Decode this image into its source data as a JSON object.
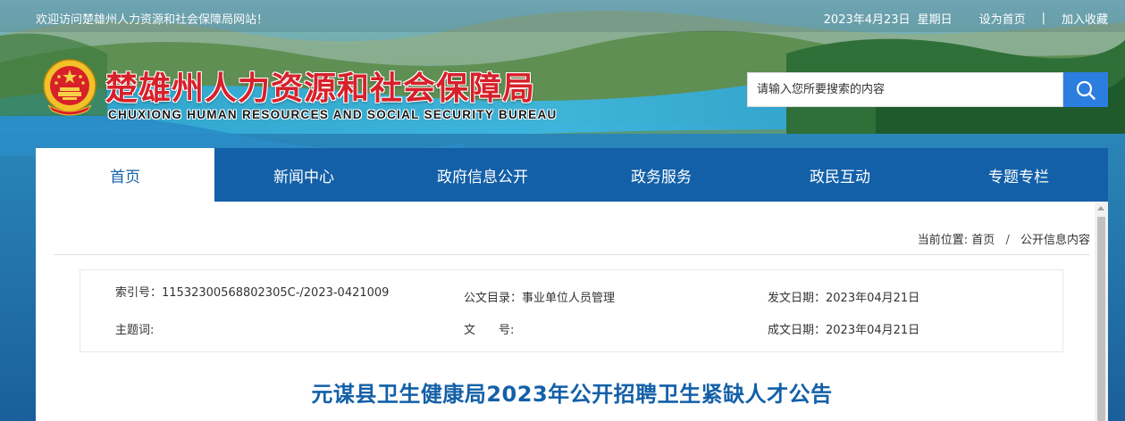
{
  "topbar": {
    "welcome": "欢迎访问楚雄州人力资源和社会保障局网站！",
    "date": "2023年4月23日",
    "weekday": "星期日",
    "set_homepage": "设为首页",
    "separator": "|",
    "add_favorite": "加入收藏"
  },
  "header": {
    "title": "楚雄州人力资源和社会保障局",
    "subtitle": "CHUXIONG HUMAN RESOURCES AND SOCIAL SECURITY BUREAU",
    "emblem_icon": "national-emblem-icon"
  },
  "search": {
    "placeholder": "请输入您所要搜索的内容",
    "icon": "search-icon",
    "button_color": "#2c7de0"
  },
  "nav": {
    "items": [
      {
        "label": "首页",
        "active": true
      },
      {
        "label": "新闻中心"
      },
      {
        "label": "政府信息公开"
      },
      {
        "label": "政务服务"
      },
      {
        "label": "政民互动"
      },
      {
        "label": "专题专栏"
      }
    ],
    "color": "#1360a8"
  },
  "breadcrumb": {
    "prefix": "当前位置:",
    "home": "首页",
    "separator": "/",
    "current": "公开信息内容"
  },
  "info": {
    "index_label": "索引号：",
    "index_value": "11532300568802305C-/2023-0421009",
    "catalog_label": "公文目录：",
    "catalog_value": "事业单位人员管理",
    "publish_label": "发文日期：",
    "publish_value": "2023年04月21日",
    "keyword_label": "主题词:",
    "keyword_value": "",
    "docno_label": "文　　号:",
    "docno_value": "",
    "created_label": "成文日期：",
    "created_value": "2023年04月21日"
  },
  "article": {
    "title": "元谋县卫生健康局2023年公开招聘卫生紧缺人才公告"
  }
}
